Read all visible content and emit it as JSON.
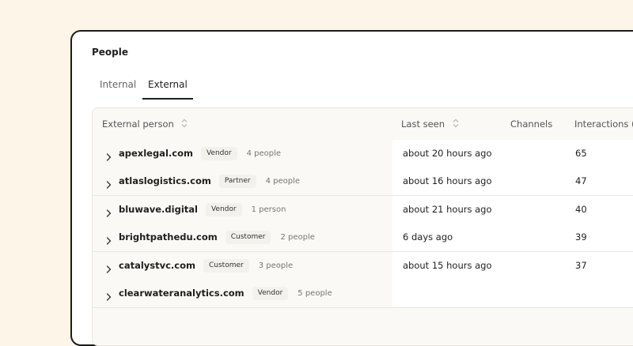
{
  "page": {
    "title": "People"
  },
  "tabs": [
    {
      "label": "Internal",
      "active": false
    },
    {
      "label": "External",
      "active": true
    }
  ],
  "table": {
    "columns": {
      "person": "External person",
      "last_seen": "Last seen",
      "channels": "Channels",
      "interactions": "Interactions ("
    },
    "rows": [
      {
        "domain": "apexlegal.com",
        "type": "Vendor",
        "people": "4 people",
        "last_seen": "about 20 hours ago",
        "channels": "",
        "interactions": "65"
      },
      {
        "domain": "atlaslogistics.com",
        "type": "Partner",
        "people": "4 people",
        "last_seen": "about 16 hours ago",
        "channels": "",
        "interactions": "47"
      },
      {
        "domain": "bluwave.digital",
        "type": "Vendor",
        "people": "1 person",
        "last_seen": "about 21 hours ago",
        "channels": "",
        "interactions": "40"
      },
      {
        "domain": "brightpathedu.com",
        "type": "Customer",
        "people": "2 people",
        "last_seen": "6 days ago",
        "channels": "",
        "interactions": "39"
      },
      {
        "domain": "catalystvc.com",
        "type": "Customer",
        "people": "3 people",
        "last_seen": "about 15 hours ago",
        "channels": "",
        "interactions": "37"
      },
      {
        "domain": "clearwateranalytics.com",
        "type": "Vendor",
        "people": "5 people",
        "last_seen": "",
        "channels": "",
        "interactions": ""
      }
    ]
  }
}
